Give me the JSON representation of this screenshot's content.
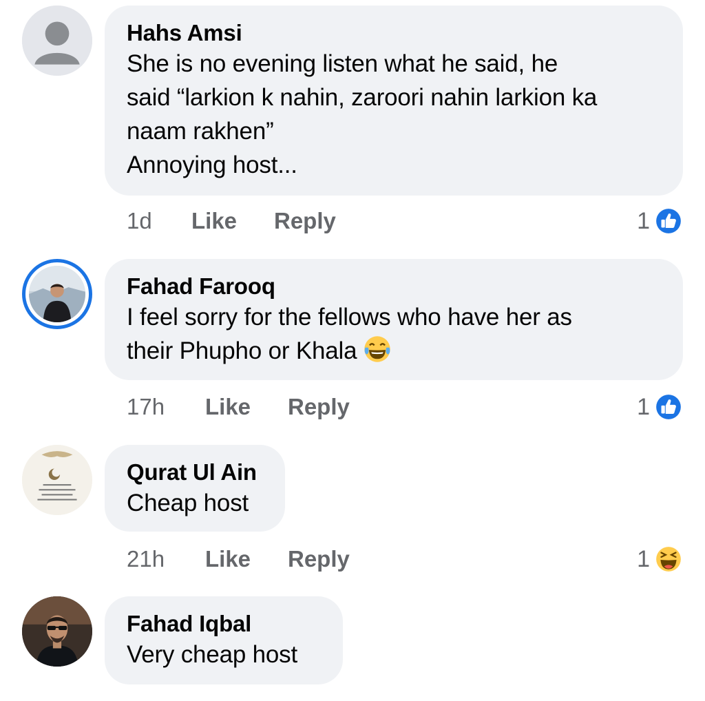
{
  "comments": [
    {
      "author": "Hahs Amsi",
      "lines": [
        "She is no evening listen what he said, he",
        "said “larkion k nahin, zaroori nahin larkion ka",
        "naam rakhen”",
        "Annoying host..."
      ],
      "time": "1d",
      "like_label": "Like",
      "reply_label": "Reply",
      "reaction_count": "1",
      "reaction_icon": "like-reaction-icon",
      "avatar_icon": "default-avatar-icon"
    },
    {
      "author": "Fahad Farooq",
      "lines": [
        "I feel sorry for the fellows who have her as",
        "their Phupho or Khala"
      ],
      "inline_emoji": "tears-of-joy-emoji",
      "time": "17h",
      "like_label": "Like",
      "reply_label": "Reply",
      "reaction_count": "1",
      "reaction_icon": "like-reaction-icon",
      "avatar_icon": "profile-photo"
    },
    {
      "author": "Qurat Ul Ain",
      "lines": [
        "Cheap host"
      ],
      "time": "21h",
      "like_label": "Like",
      "reply_label": "Reply",
      "reaction_count": "1",
      "reaction_icon": "haha-reaction-icon",
      "avatar_icon": "profile-photo"
    },
    {
      "author": "Fahad Iqbal",
      "lines": [
        "Very cheap host"
      ],
      "avatar_icon": "profile-photo"
    }
  ],
  "colors": {
    "bubble": "#f0f2f5",
    "meta_text": "#65676b",
    "like_blue": "#1b74e4",
    "emoji_yellow": "#ffcc4d"
  }
}
